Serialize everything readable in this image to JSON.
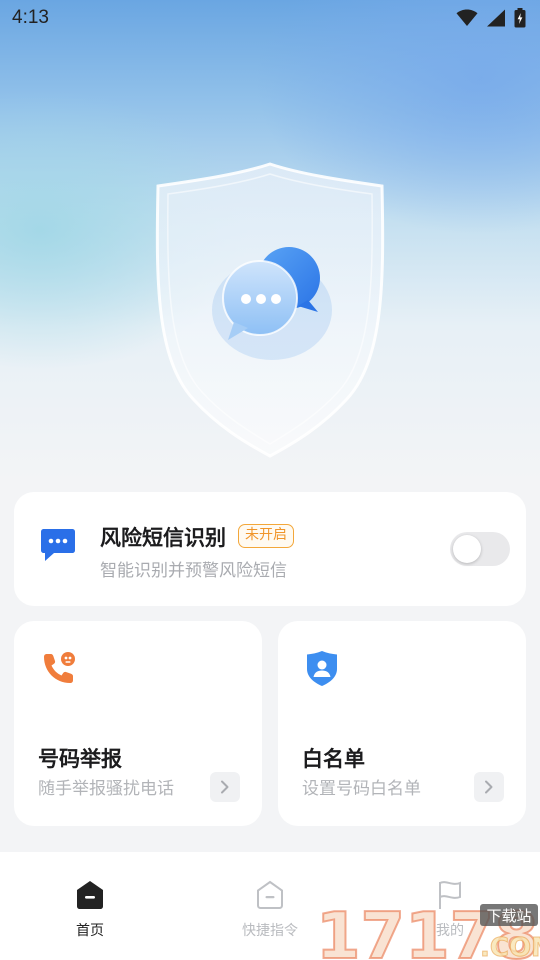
{
  "status_bar": {
    "time": "4:13"
  },
  "risk_card": {
    "title": "风险短信识别",
    "badge": "未开启",
    "subtitle": "智能识别并预警风险短信",
    "toggle_on": false
  },
  "report_card": {
    "title": "号码举报",
    "subtitle": "随手举报骚扰电话"
  },
  "whitelist_card": {
    "title": "白名单",
    "subtitle": "设置号码白名单"
  },
  "bottom_nav": {
    "items": [
      {
        "label": "首页",
        "icon": "home-icon",
        "active": true
      },
      {
        "label": "快捷指令",
        "icon": "shortcut-icon",
        "active": false
      },
      {
        "label": "我的",
        "icon": "flag-icon",
        "active": false
      }
    ]
  },
  "watermark": {
    "number": "17178",
    "tag": "下载站",
    "domain": ".COM"
  },
  "colors": {
    "accent_blue": "#2a6fe8",
    "badge_orange": "#f0952a",
    "report_orange": "#f07d3c",
    "shield_blue": "#3d8ef0"
  }
}
